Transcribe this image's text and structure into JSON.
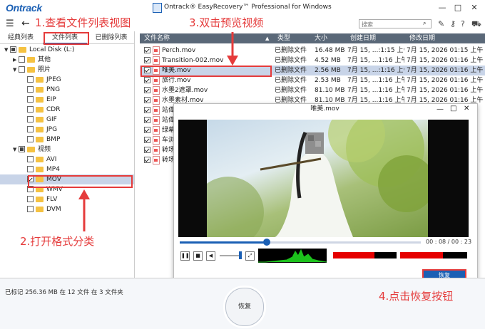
{
  "window": {
    "logo": "Ontrack",
    "title": "Ontrack® EasyRecovery™ Professional for Windows",
    "minimize": "—",
    "maximize": "□",
    "close": "✕"
  },
  "toolbar": {
    "search_placeholder": "搜索",
    "icons": [
      "menu-icon",
      "back-icon",
      "search-icon",
      "wrench-icon",
      "key-icon",
      "help-icon",
      "cart-icon"
    ]
  },
  "left_tabs": [
    "经典列表",
    "文件列表",
    "已删除列表"
  ],
  "tree": [
    {
      "label": "Local Disk (L:)",
      "level": 0,
      "arrow": "▼",
      "check": "partial"
    },
    {
      "label": "其他",
      "level": 1,
      "arrow": "▶",
      "check": "none"
    },
    {
      "label": "照片",
      "level": 1,
      "arrow": "▼",
      "check": "none"
    },
    {
      "label": "JPEG",
      "level": 2,
      "arrow": "",
      "check": "none"
    },
    {
      "label": "PNG",
      "level": 2,
      "arrow": "",
      "check": "none"
    },
    {
      "label": "EIP",
      "level": 2,
      "arrow": "",
      "check": "none"
    },
    {
      "label": "CDR",
      "level": 2,
      "arrow": "",
      "check": "none"
    },
    {
      "label": "GIF",
      "level": 2,
      "arrow": "",
      "check": "none"
    },
    {
      "label": "JPG",
      "level": 2,
      "arrow": "",
      "check": "none"
    },
    {
      "label": "BMP",
      "level": 2,
      "arrow": "",
      "check": "none"
    },
    {
      "label": "视频",
      "level": 1,
      "arrow": "▼",
      "check": "partial"
    },
    {
      "label": "AVI",
      "level": 2,
      "arrow": "",
      "check": "none"
    },
    {
      "label": "MP4",
      "level": 2,
      "arrow": "",
      "check": "none"
    },
    {
      "label": "MOV",
      "level": 2,
      "arrow": "",
      "check": "checked",
      "selected": true
    },
    {
      "label": "WMV",
      "level": 2,
      "arrow": "",
      "check": "none"
    },
    {
      "label": "FLV",
      "level": 2,
      "arrow": "",
      "check": "none"
    },
    {
      "label": "DVM",
      "level": 2,
      "arrow": "",
      "check": "none"
    }
  ],
  "list_headers": [
    "文件名称",
    "类型",
    "大小",
    "创建日期",
    "修改日期"
  ],
  "files": [
    {
      "name": "Perch.mov",
      "type": "已删除文件",
      "size": "16.48 MB",
      "created": "7月 15, ...:1:15 上午",
      "modified": "7月 15, 2026 01:15 上午"
    },
    {
      "name": "Transition-002.mov",
      "type": "已删除文件",
      "size": "4.52 MB",
      "created": "7月 15, ...1:16 上午",
      "modified": "7月 15, 2026 01:16 上午"
    },
    {
      "name": "唯美.mov",
      "type": "已删除文件",
      "size": "2.56 MB",
      "created": "7月 15, ...:1:16 上午",
      "modified": "7月 15, 2026 01:16 上午",
      "selected": true
    },
    {
      "name": "旅行.mov",
      "type": "已删除文件",
      "size": "2.53 MB",
      "created": "7月 15, ...1:16 上午",
      "modified": "7月 15, 2026 01:16 上午"
    },
    {
      "name": "水墨2遮罩.mov",
      "type": "已删除文件",
      "size": "81.10 MB",
      "created": "7月 15, ...1:16 上午",
      "modified": "7月 15, 2026 01:16 上午"
    },
    {
      "name": "水墨素材.mov",
      "type": "已删除文件",
      "size": "81.10 MB",
      "created": "7月 15, ...1:16 上午",
      "modified": "7月 15, 2026 01:16 上午"
    },
    {
      "name": "站偉",
      "type": "",
      "size": "",
      "created": "",
      "modified": ""
    },
    {
      "name": "站偉",
      "type": "",
      "size": "",
      "created": "",
      "modified": ""
    },
    {
      "name": "绿幕",
      "type": "",
      "size": "",
      "created": "",
      "modified": ""
    },
    {
      "name": "车浏",
      "type": "",
      "size": "",
      "created": "",
      "modified": ""
    },
    {
      "name": "转场",
      "type": "",
      "size": "",
      "created": "",
      "modified": ""
    },
    {
      "name": "转场",
      "type": "",
      "size": "",
      "created": "",
      "modified": ""
    }
  ],
  "preview": {
    "title": "唯美.mov",
    "time": "00 : 08  /  00 : 23",
    "progress": 0.36,
    "recover_label": "恢复"
  },
  "footer": {
    "status": "已标记 256.36 MB 在 12 文件 在 3 文件夹",
    "recover_label": "恢复"
  },
  "annotations": {
    "step1": "1.查看文件列表视图",
    "step2": "2.打开格式分类",
    "step3": "3.双击预览视频",
    "step4": "4.点击恢复按钮"
  },
  "colors": {
    "accent": "#1a5fb4",
    "annotation": "#e53b3b",
    "header": "#5a6878"
  }
}
